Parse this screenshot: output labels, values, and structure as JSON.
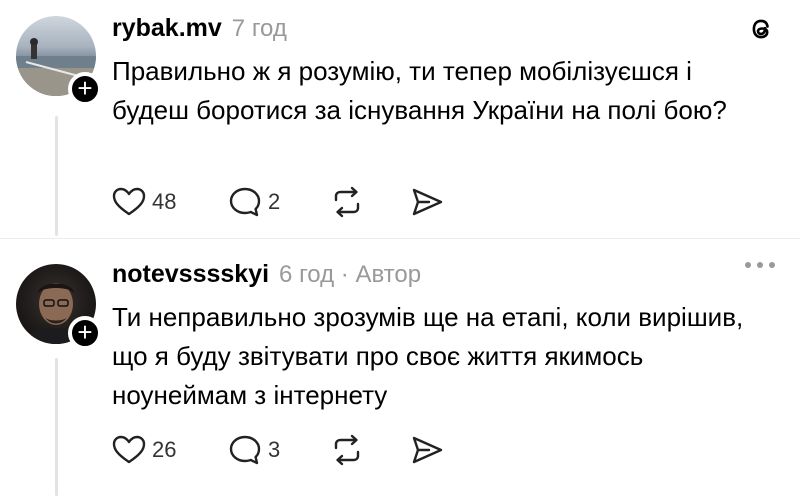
{
  "posts": [
    {
      "username": "rybak.mv",
      "time": "7 год",
      "text": "Правильно ж я розумію, ти тепер мобілізуєшся  і будеш боротися за існування України на полі бою?",
      "likes": "48",
      "replies": "2"
    },
    {
      "username": "notevsssskyi",
      "time": "6 год · Автор",
      "text": "Ти неправильно зрозумів ще на етапі, коли вирішив, що я буду звітувати про своє життя якимось ноунеймам з інтернету",
      "likes": "26",
      "replies": "3"
    }
  ],
  "icons": {
    "app": "threads-icon",
    "like": "heart-icon",
    "reply": "comment-icon",
    "repost": "repost-icon",
    "share": "send-icon",
    "follow": "plus-icon",
    "more": "more-icon"
  }
}
